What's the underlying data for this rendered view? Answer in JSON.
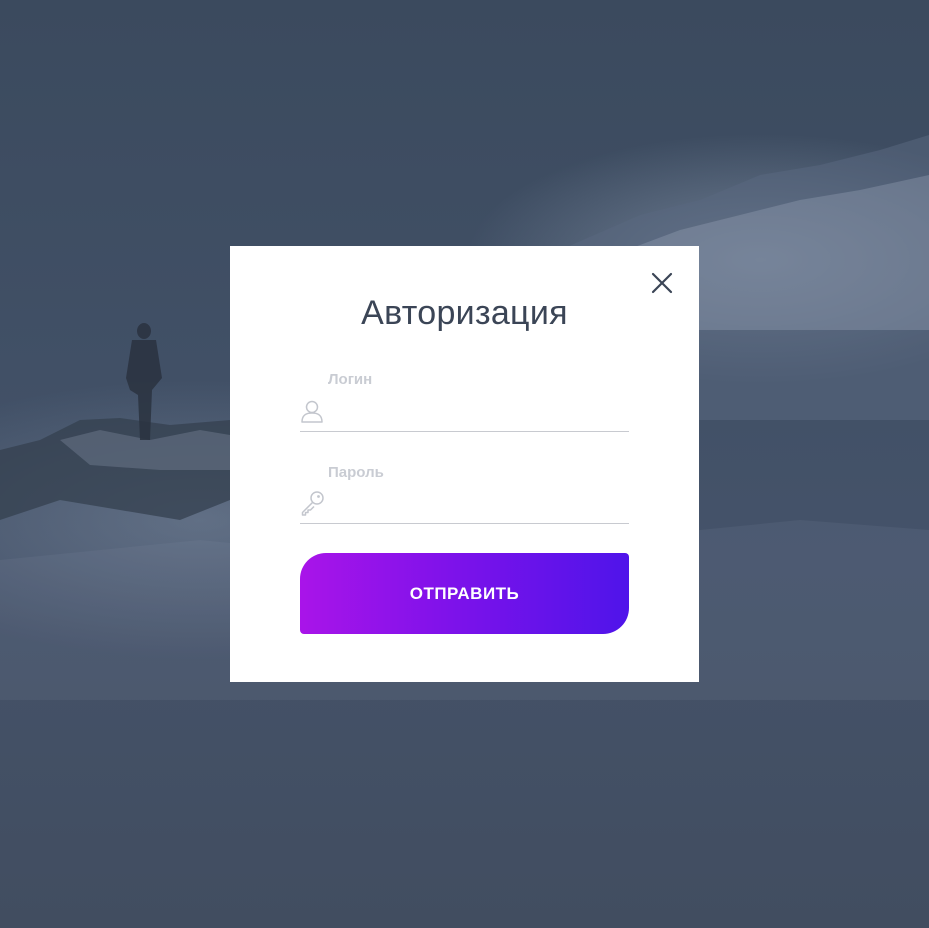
{
  "colors": {
    "overlay": "#3f4b5e",
    "modal_background": "#ffffff",
    "title_text": "#3b4556",
    "label_text": "#c9ccd3",
    "button_gradient_start": "#a914e9",
    "button_gradient_end": "#4f14ea"
  },
  "modal": {
    "title": "Авторизация",
    "close_icon": "close-icon"
  },
  "form": {
    "login": {
      "label": "Логин",
      "value": "",
      "icon": "user-icon"
    },
    "password": {
      "label": "Пароль",
      "value": "",
      "icon": "key-icon"
    },
    "submit_label": "ОТПРАВИТЬ"
  }
}
